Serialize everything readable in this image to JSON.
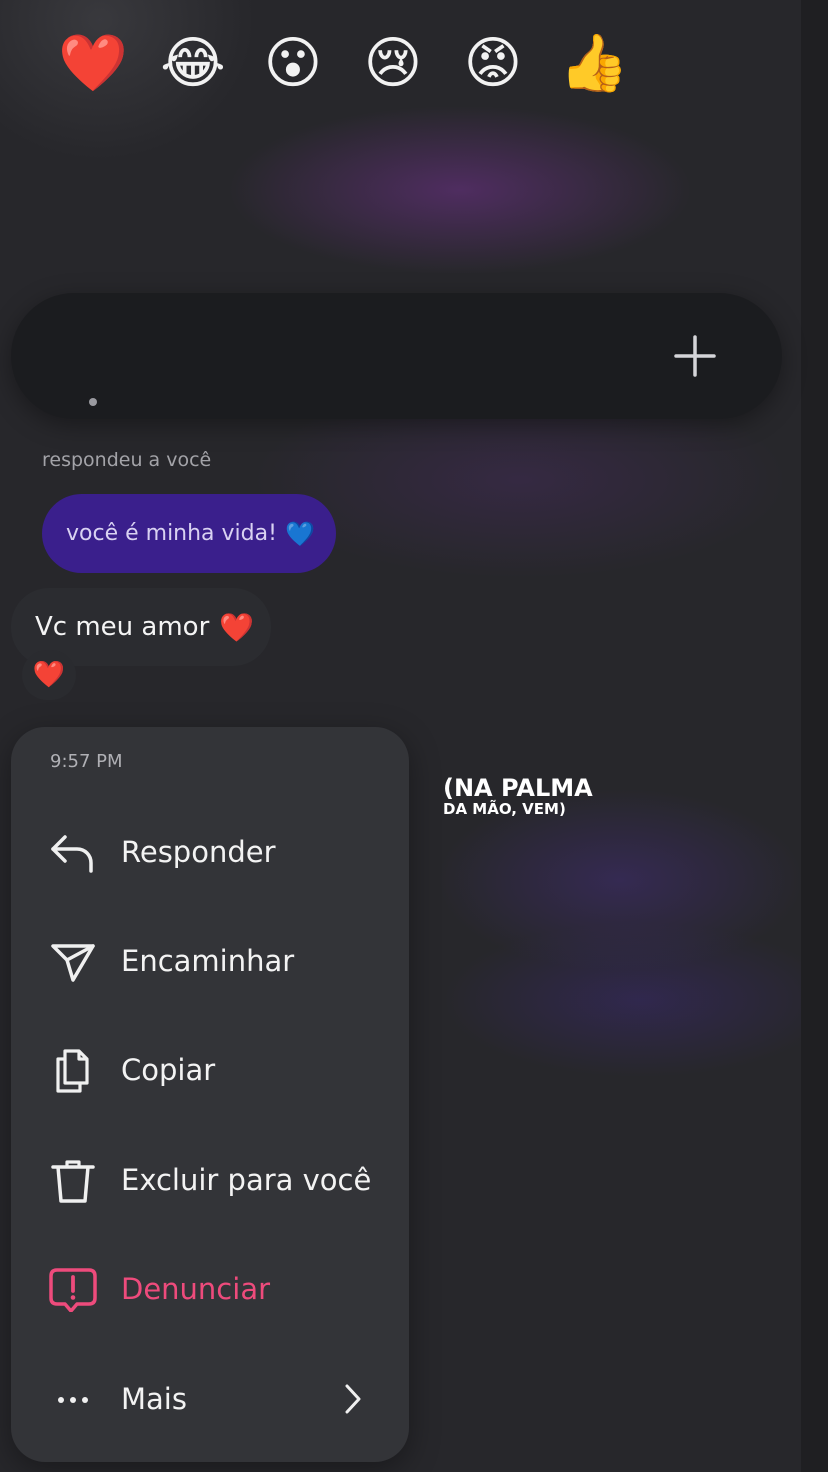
{
  "reactions": [
    {
      "emoji": "❤️",
      "icon": "red-heart-icon"
    },
    {
      "emoji": "😂",
      "icon": "tears-of-joy-icon"
    },
    {
      "emoji": "😮",
      "icon": "surprised-face-icon"
    },
    {
      "emoji": "😢",
      "icon": "crying-face-icon"
    },
    {
      "emoji": "😡",
      "icon": "angry-face-icon"
    },
    {
      "emoji": "👍",
      "icon": "thumbs-up-icon"
    }
  ],
  "conversation": {
    "replied_label": "respondeu a você",
    "quoted_text": "você é minha vida!",
    "quoted_emoji": "💙",
    "message_text": "Vc meu amor",
    "message_emoji": "❤️",
    "message_reaction": "❤️"
  },
  "menu": {
    "time": "9:57 PM",
    "items": [
      {
        "label": "Responder",
        "icon": "reply-icon"
      },
      {
        "label": "Encaminhar",
        "icon": "forward-icon"
      },
      {
        "label": "Copiar",
        "icon": "copy-icon"
      },
      {
        "label": "Excluir para você",
        "icon": "trash-icon"
      },
      {
        "label": "Denunciar",
        "icon": "report-icon"
      },
      {
        "label": "Mais",
        "icon": "more-icon"
      }
    ]
  },
  "caption": {
    "line1": "(NA PALMA",
    "line2": "DA MÃO, VEM)"
  },
  "colors": {
    "background": "#27272b",
    "reaction_bar": "#1b1c1f",
    "quoted_bubble": "#3a1f8c",
    "menu": "#333438",
    "danger": "#ee4b7c"
  }
}
